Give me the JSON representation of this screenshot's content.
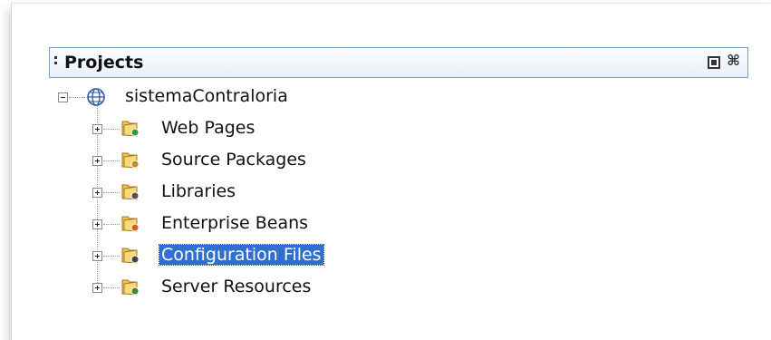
{
  "panel": {
    "title": "Projects"
  },
  "tree": {
    "root": {
      "label": "sistemaContraloria",
      "icon": "project-globe-icon",
      "expanded": true
    },
    "children": [
      {
        "label": "Web Pages",
        "icon": "web-pages-folder-icon",
        "badge_color": "#2e9e3e"
      },
      {
        "label": "Source Packages",
        "icon": "source-packages-folder-icon",
        "badge_color": "#c88a20"
      },
      {
        "label": "Libraries",
        "icon": "libraries-folder-icon",
        "badge_color": "#555555"
      },
      {
        "label": "Enterprise Beans",
        "icon": "enterprise-beans-folder-icon",
        "badge_color": "#d0601a"
      },
      {
        "label": "Configuration Files",
        "icon": "configuration-files-folder-icon",
        "badge_color": "#444444",
        "selected": true
      },
      {
        "label": "Server Resources",
        "icon": "server-resources-folder-icon",
        "badge_color": "#3a8a3a"
      }
    ]
  },
  "colors": {
    "selection": "#2f6fce",
    "folder": "#f0c24a",
    "header_border": "#7f9db9"
  }
}
